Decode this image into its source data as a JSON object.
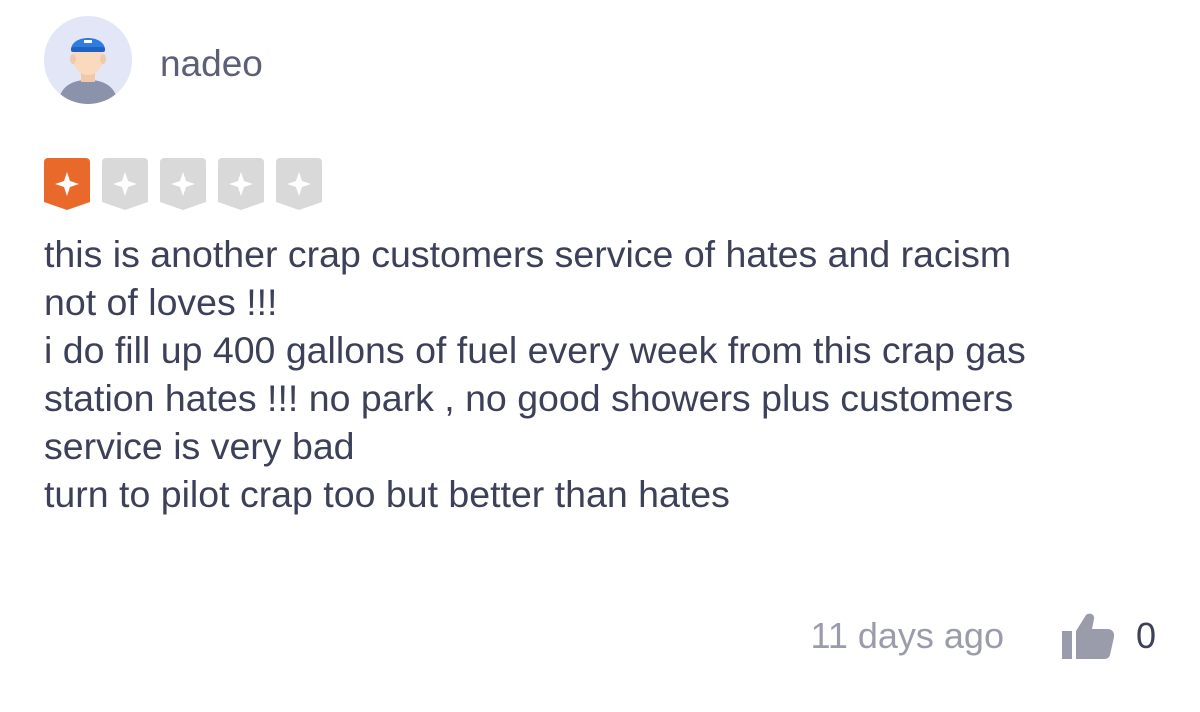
{
  "review": {
    "user": {
      "name": "nadeo",
      "avatar_icon": "user-avatar-icon"
    },
    "rating": {
      "value": 1,
      "max": 5,
      "active_color": "#e8692a",
      "inactive_color": "#d9d9d9",
      "icon": "sparkle-badge-icon"
    },
    "text_lines": [
      "this is another crap customers service of hates and racism",
      "not of loves !!!",
      "i do fill up 400 gallons of fuel every week from this crap gas",
      "station hates !!! no park , no good showers plus customers",
      "service is very bad",
      "turn to pilot crap too but better than hates"
    ],
    "timestamp": "11 days ago",
    "likes": {
      "icon": "thumbs-up-icon",
      "count": "0"
    }
  }
}
